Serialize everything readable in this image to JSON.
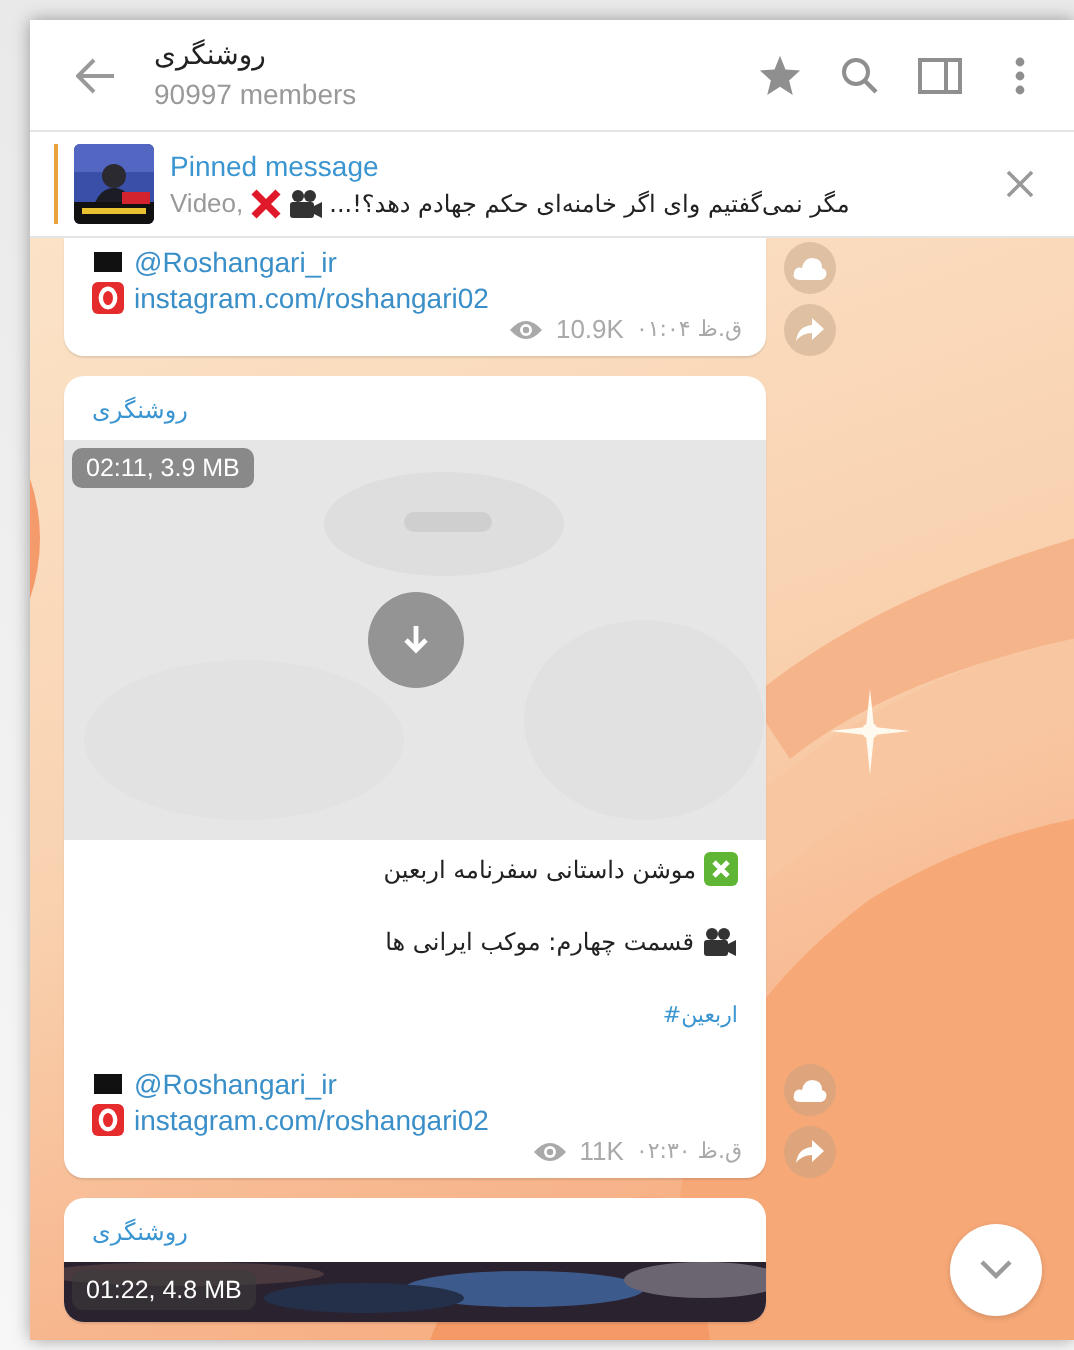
{
  "header": {
    "title": "روشنگری",
    "subtitle": "90997 members"
  },
  "pinned": {
    "label": "Pinned message",
    "prefix": "Video,",
    "text": "مگر نمی‌گفتیم وای اگر خامنه‌ای حکم جهادم دهد؟!..."
  },
  "messages": [
    {
      "kind": "tail",
      "links": [
        {
          "kind": "flag",
          "text": "@Roshangari_ir"
        },
        {
          "kind": "instagram",
          "text": "instagram.com/roshangari02"
        }
      ],
      "views": "10.9K",
      "time": "ق.ظ ۰۱:۰۴"
    },
    {
      "kind": "video",
      "sender": "روشنگری",
      "media": {
        "kind": "light",
        "badge": "02:11, 3.9 MB"
      },
      "caption": [
        {
          "kind": "cross",
          "text": "موشن داستانی سفرنامه اربعین"
        },
        {
          "kind": "camera",
          "text": "قسمت چهارم: موکب ایرانی ها"
        }
      ],
      "hashtag": "#اربعین",
      "links": [
        {
          "kind": "flag",
          "text": "@Roshangari_ir"
        },
        {
          "kind": "instagram",
          "text": "instagram.com/roshangari02"
        }
      ],
      "views": "11K",
      "time": "ق.ظ ۰۲:۳۰"
    },
    {
      "kind": "video",
      "sender": "روشنگری",
      "media": {
        "kind": "dark",
        "badge": "01:22, 4.8 MB"
      }
    }
  ]
}
